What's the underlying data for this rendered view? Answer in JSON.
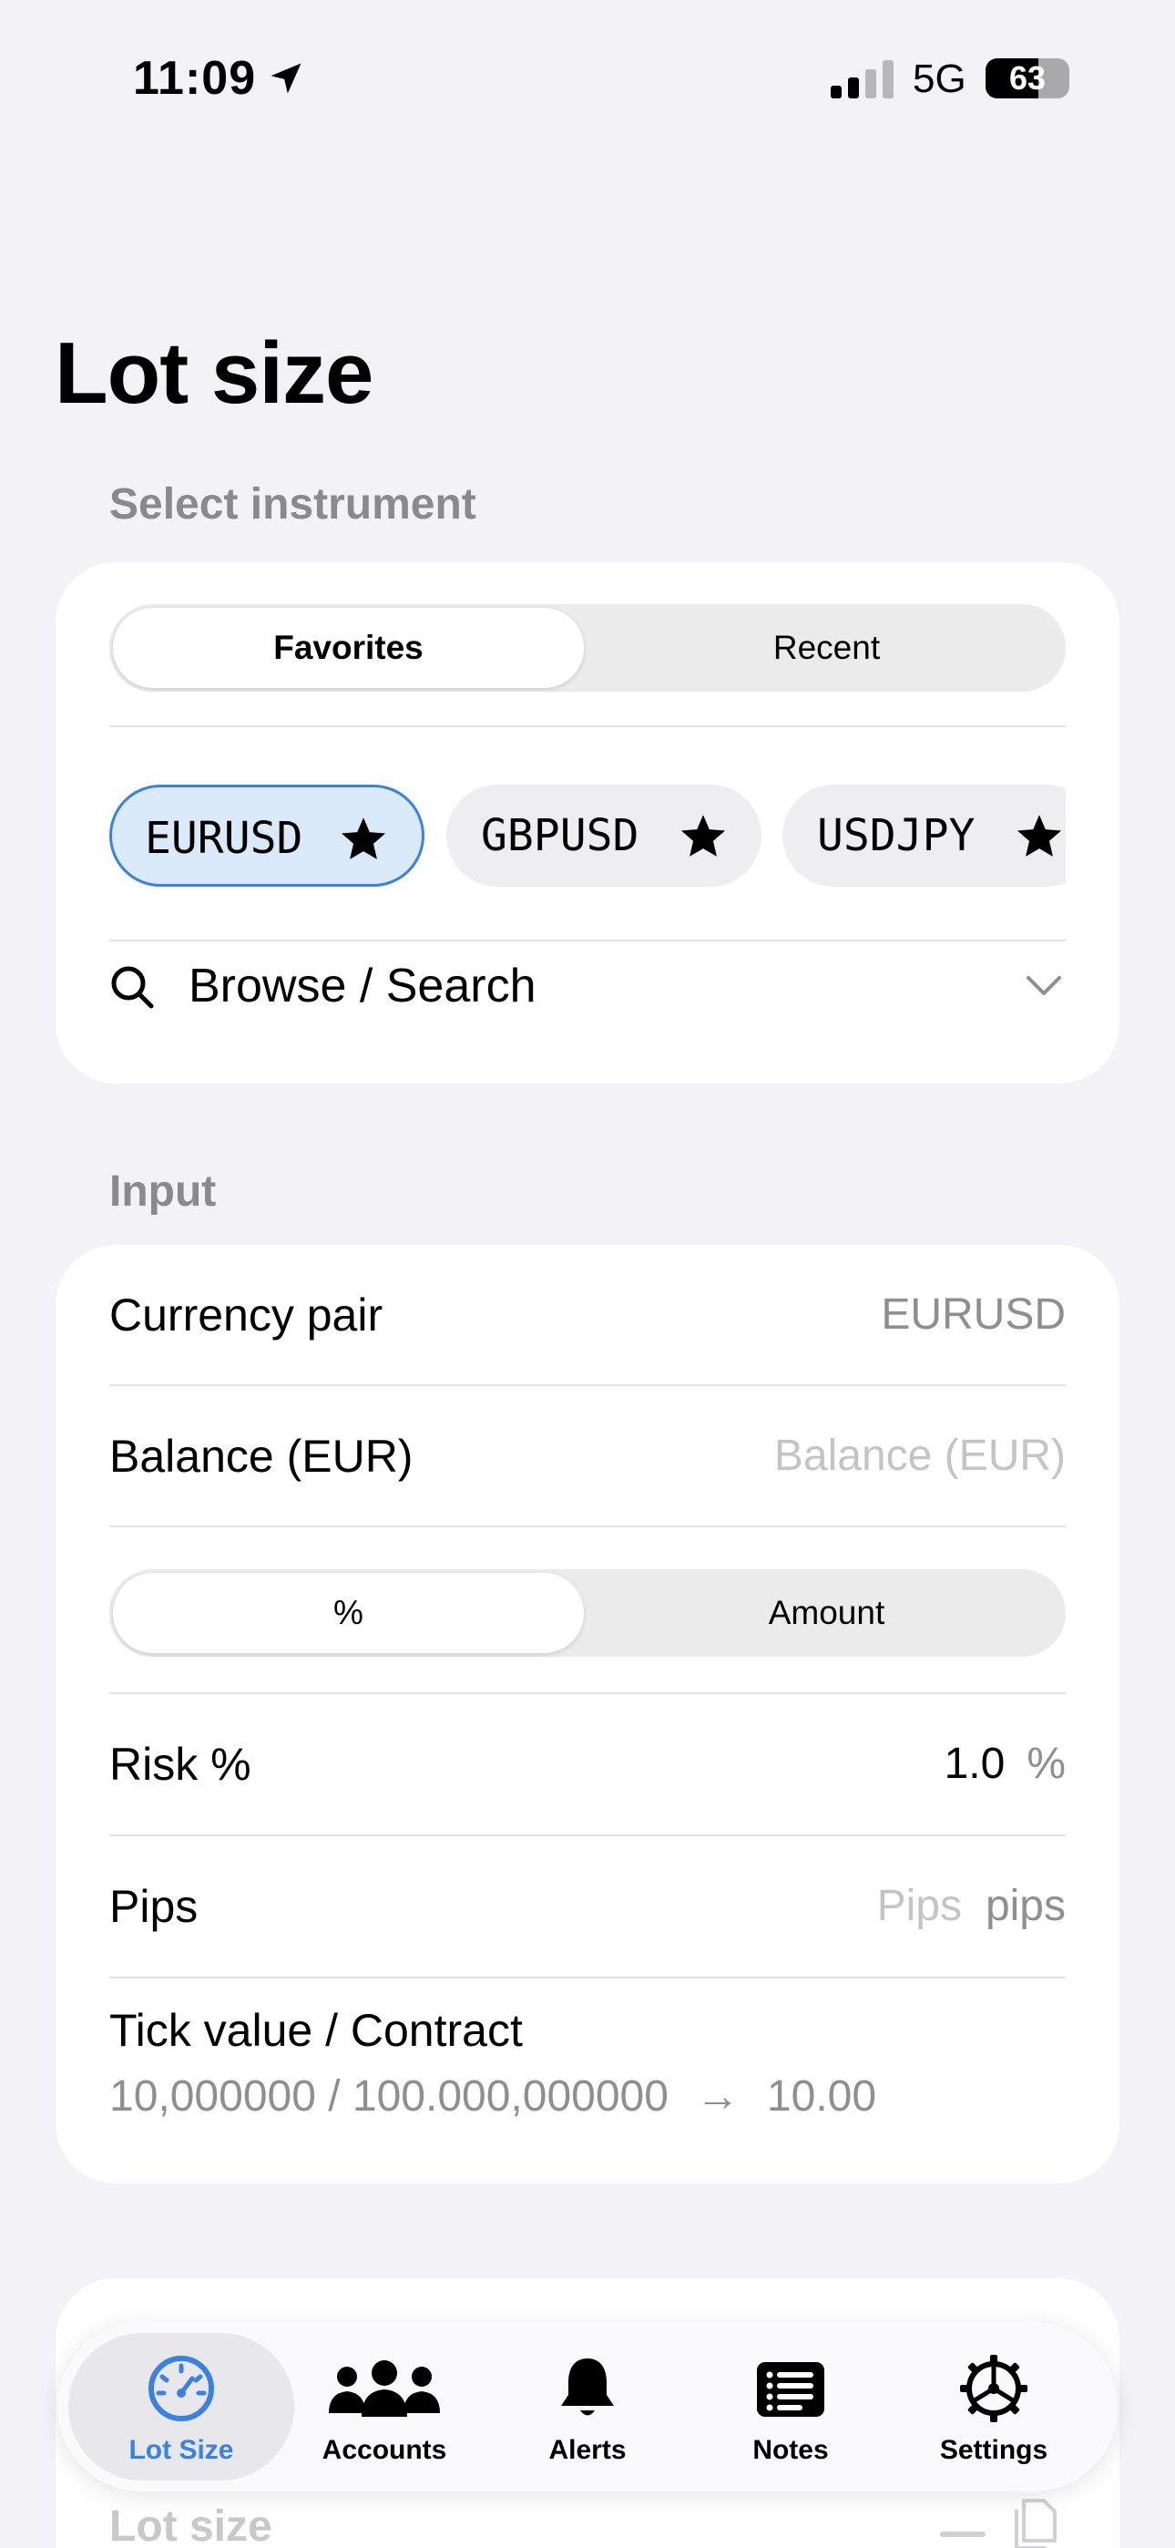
{
  "status_bar": {
    "time": "11:09",
    "network": "5G",
    "battery_percent": 63,
    "battery_label": "63"
  },
  "page_title": "Lot size",
  "select_instrument": {
    "section_label": "Select instrument",
    "segments": [
      {
        "label": "Favorites",
        "selected": true
      },
      {
        "label": "Recent",
        "selected": false
      }
    ],
    "favorites": [
      {
        "symbol": "EURUSD",
        "selected": true,
        "starred": true
      },
      {
        "symbol": "GBPUSD",
        "selected": false,
        "starred": true
      },
      {
        "symbol": "USDJPY",
        "selected": false,
        "starred": true
      }
    ],
    "browse_label": "Browse / Search"
  },
  "input": {
    "section_label": "Input",
    "currency_pair": {
      "label": "Currency pair",
      "value": "EURUSD"
    },
    "balance": {
      "label": "Balance (EUR)",
      "placeholder": "Balance (EUR)"
    },
    "risk_mode": [
      {
        "label": "%",
        "selected": true
      },
      {
        "label": "Amount",
        "selected": false
      }
    ],
    "risk": {
      "label": "Risk %",
      "value": "1.0",
      "unit": "%"
    },
    "pips": {
      "label": "Pips",
      "placeholder": "Pips",
      "unit": "pips"
    },
    "tick": {
      "label": "Tick value / Contract",
      "detail": "10,000000 / 100.000,000000",
      "arrow": "→",
      "result": "10.00"
    }
  },
  "lower_section": {
    "label": "Lot size"
  },
  "tab_bar": {
    "items": [
      {
        "label": "Lot Size",
        "icon": "gauge-icon",
        "active": true
      },
      {
        "label": "Accounts",
        "icon": "people-icon",
        "active": false
      },
      {
        "label": "Alerts",
        "icon": "bell-icon",
        "active": false
      },
      {
        "label": "Notes",
        "icon": "notes-icon",
        "active": false
      },
      {
        "label": "Settings",
        "icon": "gear-icon",
        "active": false
      }
    ]
  },
  "colors": {
    "accent": "#3b82e0",
    "background": "#f2f2f7",
    "card": "#ffffff",
    "secondary_text": "#8e8e93",
    "placeholder_text": "#c4c4c8"
  }
}
